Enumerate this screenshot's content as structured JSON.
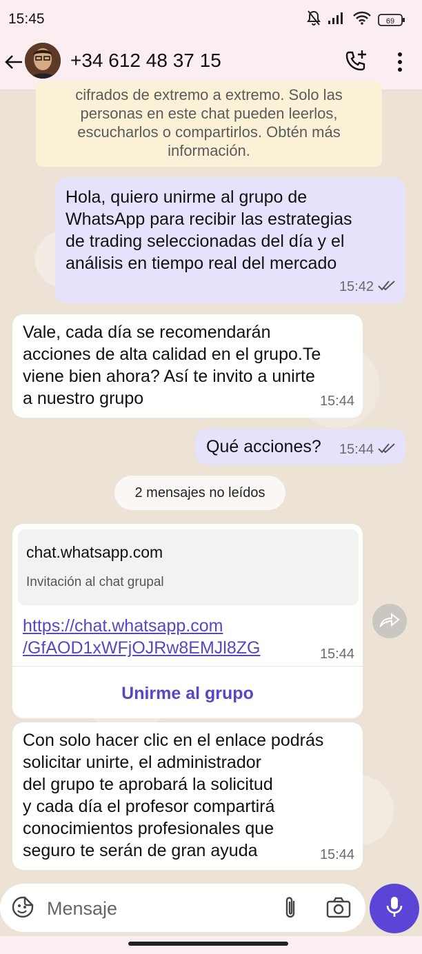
{
  "status": {
    "time": "15:45",
    "battery": "69",
    "icons": [
      "mute-bell-icon",
      "signal-icon",
      "wifi-icon",
      "battery-icon"
    ]
  },
  "header": {
    "contact": "+34 612 48 37 15",
    "icons": [
      "back-arrow-icon",
      "avatar",
      "add-call-icon",
      "more-vert-icon"
    ]
  },
  "notice": {
    "lines": [
      "cifrados de extremo a extremo. Solo las",
      "personas en este chat pueden leerlos,",
      "escucharlos o compartirlos. Obtén más",
      "información."
    ]
  },
  "messages": [
    {
      "direction": "out",
      "lines": [
        "Hola, quiero unirme al grupo de",
        "WhatsApp para recibir las estrategias",
        "de trading seleccionadas del día y el",
        "análisis en tiempo real del mercado"
      ],
      "time": "15:42",
      "status": "read"
    },
    {
      "direction": "in",
      "lines": [
        "Vale, cada día se recomendarán",
        "acciones de alta calidad en el grupo.Te",
        "viene bien ahora? Así te invito a unirte",
        "a nuestro grupo"
      ],
      "time": "15:44"
    },
    {
      "direction": "out",
      "lines": [
        "Qué acciones?"
      ],
      "time": "15:44",
      "status": "read"
    }
  ],
  "unread_label": "2 mensajes no leídos",
  "link_message": {
    "domain": "chat.whatsapp.com",
    "description": "Invitación al chat grupal",
    "url_lines": [
      "https://chat.whatsapp.com",
      "/GfAOD1xWFjOJRw8EMJl8ZG"
    ],
    "time": "15:44",
    "button": "Unirme al grupo"
  },
  "last_message": {
    "lines": [
      "Con solo hacer clic en el enlace podrás",
      "solicitar unirte, el administrador",
      "del grupo te aprobará la solicitud",
      "y cada día el profesor compartirá",
      "conocimientos profesionales que",
      "seguro te serán de gran ayuda"
    ],
    "time": "15:44"
  },
  "input": {
    "placeholder": "Mensaje"
  },
  "colors": {
    "accent": "#5a45d6",
    "outgoing_bubble": "#e6e2fb",
    "incoming_bubble": "#ffffff",
    "notice_bg": "#fbf1d6"
  }
}
